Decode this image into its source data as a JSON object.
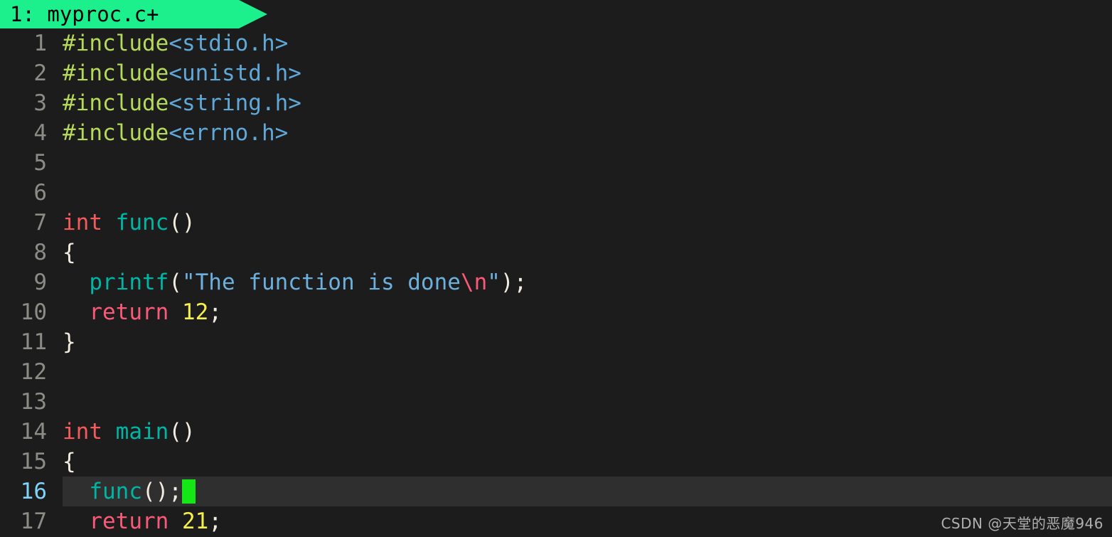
{
  "editor": {
    "background_color": "#1c1c1c",
    "current_line_highlight_color": "#2f2f2f",
    "cursor_color": "#15e615",
    "gutter_color": "#8c8c86",
    "current_line_number_color": "#7fd3f7"
  },
  "tab": {
    "label": "1: myproc.c+",
    "index": "1",
    "filename": "myproc.c",
    "modified_marker": "+",
    "background_color": "#1cf08c",
    "text_color": "#000000"
  },
  "cursor": {
    "line": 16,
    "column": 11
  },
  "lines": [
    {
      "number": "1",
      "current": false,
      "tokens": [
        {
          "text": "#include",
          "type": "pp"
        },
        {
          "text": "<stdio.h>",
          "type": "header"
        }
      ]
    },
    {
      "number": "2",
      "current": false,
      "tokens": [
        {
          "text": "#include",
          "type": "pp"
        },
        {
          "text": "<unistd.h>",
          "type": "header"
        }
      ]
    },
    {
      "number": "3",
      "current": false,
      "tokens": [
        {
          "text": "#include",
          "type": "pp"
        },
        {
          "text": "<string.h>",
          "type": "header"
        }
      ]
    },
    {
      "number": "4",
      "current": false,
      "tokens": [
        {
          "text": "#include",
          "type": "pp"
        },
        {
          "text": "<errno.h>",
          "type": "header"
        }
      ]
    },
    {
      "number": "5",
      "current": false,
      "tokens": []
    },
    {
      "number": "6",
      "current": false,
      "tokens": []
    },
    {
      "number": "7",
      "current": false,
      "tokens": [
        {
          "text": "int",
          "type": "type"
        },
        {
          "text": " ",
          "type": "plain"
        },
        {
          "text": "func",
          "type": "func"
        },
        {
          "text": "()",
          "type": "punc"
        }
      ]
    },
    {
      "number": "8",
      "current": false,
      "tokens": [
        {
          "text": "{",
          "type": "punc"
        }
      ]
    },
    {
      "number": "9",
      "current": false,
      "tokens": [
        {
          "text": "  ",
          "type": "plain"
        },
        {
          "text": "printf",
          "type": "func"
        },
        {
          "text": "(",
          "type": "punc"
        },
        {
          "text": "\"The function is done",
          "type": "string"
        },
        {
          "text": "\\n",
          "type": "escape"
        },
        {
          "text": "\"",
          "type": "string"
        },
        {
          "text": ");",
          "type": "punc"
        }
      ]
    },
    {
      "number": "10",
      "current": false,
      "tokens": [
        {
          "text": "  ",
          "type": "plain"
        },
        {
          "text": "return",
          "type": "kw"
        },
        {
          "text": " ",
          "type": "plain"
        },
        {
          "text": "12",
          "type": "num"
        },
        {
          "text": ";",
          "type": "punc"
        }
      ]
    },
    {
      "number": "11",
      "current": false,
      "tokens": [
        {
          "text": "}",
          "type": "punc"
        }
      ]
    },
    {
      "number": "12",
      "current": false,
      "tokens": []
    },
    {
      "number": "13",
      "current": false,
      "tokens": []
    },
    {
      "number": "14",
      "current": false,
      "tokens": [
        {
          "text": "int",
          "type": "type"
        },
        {
          "text": " ",
          "type": "plain"
        },
        {
          "text": "main",
          "type": "func"
        },
        {
          "text": "()",
          "type": "punc"
        }
      ]
    },
    {
      "number": "15",
      "current": false,
      "tokens": [
        {
          "text": "{",
          "type": "punc"
        }
      ]
    },
    {
      "number": "16",
      "current": true,
      "cursor_after": true,
      "tokens": [
        {
          "text": "  ",
          "type": "plain"
        },
        {
          "text": "func",
          "type": "func"
        },
        {
          "text": "();",
          "type": "punc"
        }
      ]
    },
    {
      "number": "17",
      "current": false,
      "tokens": [
        {
          "text": "  ",
          "type": "plain"
        },
        {
          "text": "return",
          "type": "kw"
        },
        {
          "text": " ",
          "type": "plain"
        },
        {
          "text": "21",
          "type": "num"
        },
        {
          "text": ";",
          "type": "punc"
        }
      ]
    }
  ],
  "watermark": {
    "text": "CSDN @天堂的恶魔946"
  }
}
